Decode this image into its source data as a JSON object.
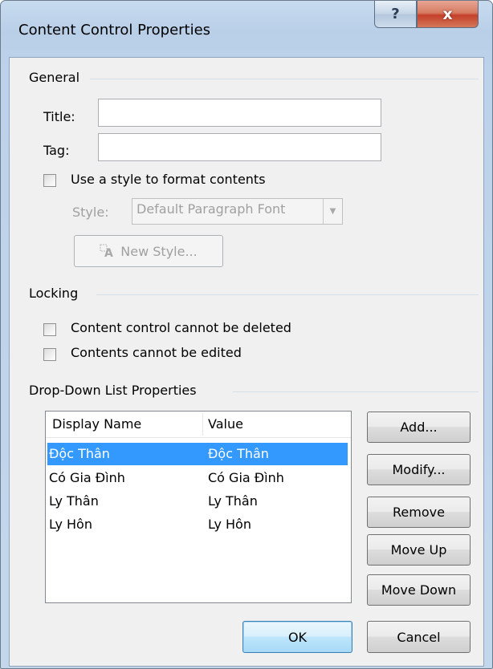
{
  "window": {
    "title": "Content Control Properties",
    "help_glyph": "?",
    "close_glyph": "x"
  },
  "general": {
    "label": "General",
    "title_label": "Title:",
    "title_value": "",
    "tag_label": "Tag:",
    "tag_value": "",
    "use_style_label": "Use a style to format contents",
    "use_style_checked": false,
    "style_label": "Style:",
    "style_value": "Default Paragraph Font",
    "new_style_label": "New Style..."
  },
  "locking": {
    "label": "Locking",
    "cannot_delete_label": "Content control cannot be deleted",
    "cannot_delete_checked": false,
    "cannot_edit_label": "Contents cannot be edited",
    "cannot_edit_checked": false
  },
  "dropdown": {
    "label": "Drop-Down List Properties",
    "columns": [
      "Display Name",
      "Value"
    ],
    "items": [
      {
        "display": "Độc Thân",
        "value": "Độc Thân",
        "selected": true
      },
      {
        "display": "Có Gia Đình",
        "value": "Có Gia Đình",
        "selected": false
      },
      {
        "display": "Ly Thân",
        "value": "Ly Thân",
        "selected": false
      },
      {
        "display": "Ly Hôn",
        "value": "Ly Hôn",
        "selected": false
      }
    ],
    "buttons": {
      "add": "Add...",
      "modify": "Modify...",
      "remove": "Remove",
      "move_up": "Move Up",
      "move_down": "Move Down"
    }
  },
  "footer": {
    "ok": "OK",
    "cancel": "Cancel"
  },
  "colors": {
    "selection": "#3399ff",
    "close_button": "#c4402a",
    "dialog_face": "#f0f0f0"
  }
}
